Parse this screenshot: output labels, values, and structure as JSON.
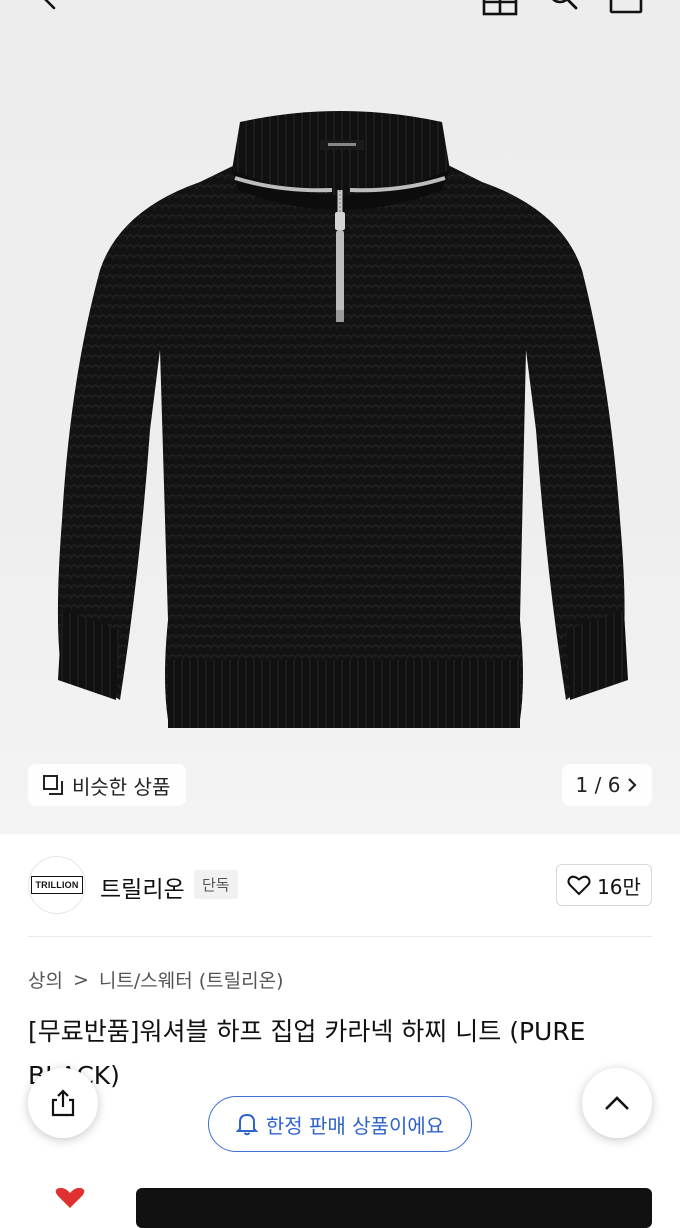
{
  "topbar": {
    "icons": [
      "back-arrow-icon",
      "gift-icon",
      "search-icon",
      "cart-icon"
    ]
  },
  "hero": {
    "similar_label": "비슷한 상품",
    "pager": "1 / 6",
    "background": "#eeeeee"
  },
  "brand": {
    "logo_text": "TRILLION",
    "name": "트릴리온",
    "badge": "단독",
    "likes": "16만"
  },
  "breadcrumb": {
    "level1": "상의",
    "separator": ">",
    "level2": "니트/스웨터 (트릴리온)"
  },
  "product": {
    "title": "[무료반품]워셔블 하프 집업 카라넥 하찌 니트 (PURE BLACK)"
  },
  "toast": {
    "label": "한정 판매 상품이에요",
    "color": "#2f63cc"
  },
  "colors": {
    "accent": "#2f63cc",
    "like_heart": "#e03131"
  }
}
